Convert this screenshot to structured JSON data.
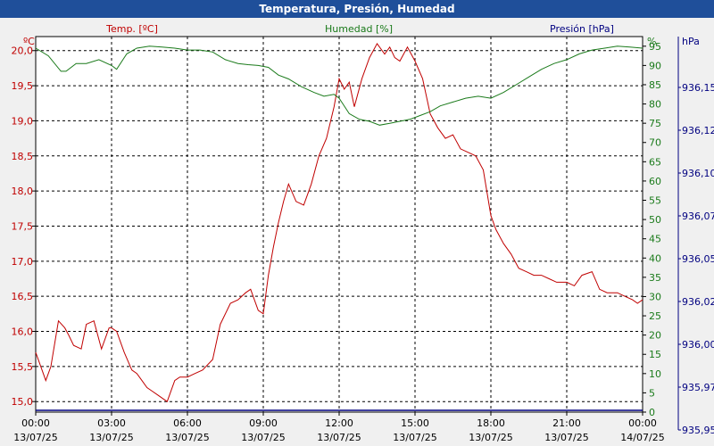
{
  "window": {
    "title": "Temperatura, Presión, Humedad"
  },
  "chart_data": {
    "type": "line",
    "title": "Temperatura, Presión, Humedad",
    "colors": {
      "temp": "#c00000",
      "hum": "#1a7a1a",
      "pres": "#000080",
      "grid": "#000000",
      "plot_bg": "#ffffff"
    },
    "x_ticks": [
      {
        "time": "00:00",
        "date": "13/07/25"
      },
      {
        "time": "03:00",
        "date": "13/07/25"
      },
      {
        "time": "06:00",
        "date": "13/07/25"
      },
      {
        "time": "09:00",
        "date": "13/07/25"
      },
      {
        "time": "12:00",
        "date": "13/07/25"
      },
      {
        "time": "15:00",
        "date": "13/07/25"
      },
      {
        "time": "18:00",
        "date": "13/07/25"
      },
      {
        "time": "21:00",
        "date": "13/07/25"
      },
      {
        "time": "00:00",
        "date": "14/07/25"
      }
    ],
    "xlim_hours": [
      0,
      24
    ],
    "axes": {
      "temp": {
        "label": "Temp. [ºC]",
        "unit": "ºC",
        "ylim": [
          14.85,
          20.2
        ],
        "ticks": [
          "15,0",
          "15,5",
          "16,0",
          "16,5",
          "17,0",
          "17,5",
          "18,0",
          "18,5",
          "19,0",
          "19,5",
          "20,0"
        ]
      },
      "hum": {
        "label": "Humedad [%]",
        "unit": "%",
        "ylim": [
          0,
          97.5
        ],
        "ticks": [
          "0",
          "5",
          "10",
          "15",
          "20",
          "25",
          "30",
          "35",
          "40",
          "45",
          "50",
          "55",
          "60",
          "65",
          "70",
          "75",
          "80",
          "85",
          "90",
          "95"
        ]
      },
      "pres": {
        "label": "Presión [hPa]",
        "unit": "hPa",
        "ticks": [
          "936,15",
          "936,12",
          "936,10",
          "936,07",
          "936,05",
          "936,02",
          "936,00",
          "935,97",
          "935,95"
        ]
      }
    },
    "series": [
      {
        "name": "Temp. [ºC]",
        "key": "temp",
        "x": [
          0,
          0.2,
          0.4,
          0.6,
          0.9,
          1.15,
          1.3,
          1.5,
          1.8,
          2.0,
          2.3,
          2.6,
          2.9,
          3.0,
          3.2,
          3.5,
          3.8,
          4.0,
          4.2,
          4.4,
          4.6,
          4.8,
          5.0,
          5.2,
          5.5,
          5.7,
          6.0,
          6.3,
          6.6,
          7.0,
          7.3,
          7.7,
          8.0,
          8.3,
          8.5,
          8.8,
          9.0,
          9.2,
          9.4,
          9.6,
          9.8,
          10.0,
          10.3,
          10.6,
          10.9,
          11.2,
          11.5,
          11.8,
          12.0,
          12.2,
          12.4,
          12.6,
          12.9,
          13.2,
          13.5,
          13.8,
          14.0,
          14.2,
          14.4,
          14.7,
          15.0,
          15.3,
          15.6,
          15.9,
          16.2,
          16.5,
          16.8,
          17.1,
          17.4,
          17.7,
          18.0,
          18.2,
          18.5,
          18.8,
          19.1,
          19.4,
          19.7,
          20.0,
          20.3,
          20.6,
          21.0,
          21.3,
          21.6,
          22.0,
          22.3,
          22.6,
          23.0,
          23.3,
          23.6,
          23.8,
          24.0
        ],
        "values": [
          15.7,
          15.5,
          15.3,
          15.5,
          16.15,
          16.05,
          15.95,
          15.8,
          15.75,
          16.1,
          16.15,
          15.75,
          16.05,
          16.05,
          16.0,
          15.7,
          15.45,
          15.4,
          15.3,
          15.2,
          15.15,
          15.1,
          15.05,
          15.0,
          15.3,
          15.35,
          15.35,
          15.4,
          15.45,
          15.6,
          16.1,
          16.4,
          16.45,
          16.55,
          16.6,
          16.3,
          16.25,
          16.8,
          17.2,
          17.55,
          17.85,
          18.1,
          17.85,
          17.8,
          18.1,
          18.5,
          18.75,
          19.2,
          19.6,
          19.45,
          19.55,
          19.2,
          19.6,
          19.9,
          20.1,
          19.95,
          20.05,
          19.9,
          19.85,
          20.05,
          19.85,
          19.6,
          19.1,
          18.9,
          18.75,
          18.8,
          18.6,
          18.55,
          18.5,
          18.3,
          17.65,
          17.45,
          17.25,
          17.1,
          16.9,
          16.85,
          16.8,
          16.8,
          16.75,
          16.7,
          16.7,
          16.65,
          16.8,
          16.85,
          16.6,
          16.55,
          16.55,
          16.5,
          16.45,
          16.4,
          16.45
        ]
      },
      {
        "name": "Humedad [%]",
        "key": "hum",
        "x": [
          0,
          0.5,
          1.0,
          1.2,
          1.6,
          2.0,
          2.5,
          3.0,
          3.2,
          3.6,
          4.0,
          4.5,
          5.0,
          5.5,
          6.0,
          6.5,
          7.0,
          7.5,
          8.0,
          8.4,
          8.8,
          9.2,
          9.6,
          10.0,
          10.5,
          11.0,
          11.4,
          11.8,
          12.0,
          12.4,
          12.8,
          13.2,
          13.6,
          14.0,
          14.4,
          14.8,
          15.2,
          15.6,
          16.0,
          16.5,
          17.0,
          17.5,
          18.0,
          18.5,
          19.0,
          19.5,
          20.0,
          20.5,
          21.0,
          21.5,
          22.0,
          22.5,
          23.0,
          23.5,
          24.0
        ],
        "values": [
          94.5,
          92.5,
          88.5,
          88.5,
          90.5,
          90.5,
          91.5,
          90.0,
          89.0,
          93.0,
          94.5,
          95.0,
          94.8,
          94.5,
          94.0,
          94.0,
          93.5,
          91.5,
          90.5,
          90.2,
          90.0,
          89.5,
          87.5,
          86.5,
          84.5,
          83.0,
          82.0,
          82.5,
          81.5,
          77.5,
          76.0,
          75.5,
          74.5,
          75.0,
          75.5,
          76.0,
          77.0,
          78.0,
          79.5,
          80.5,
          81.5,
          82.0,
          81.5,
          83.0,
          85.0,
          87.0,
          89.0,
          90.5,
          91.5,
          93.0,
          94.0,
          94.5,
          95.0,
          94.8,
          94.5
        ]
      },
      {
        "name": "Presión [hPa]",
        "key": "pres",
        "x": [
          0,
          24
        ],
        "values": [
          935.95,
          935.95
        ]
      }
    ]
  }
}
